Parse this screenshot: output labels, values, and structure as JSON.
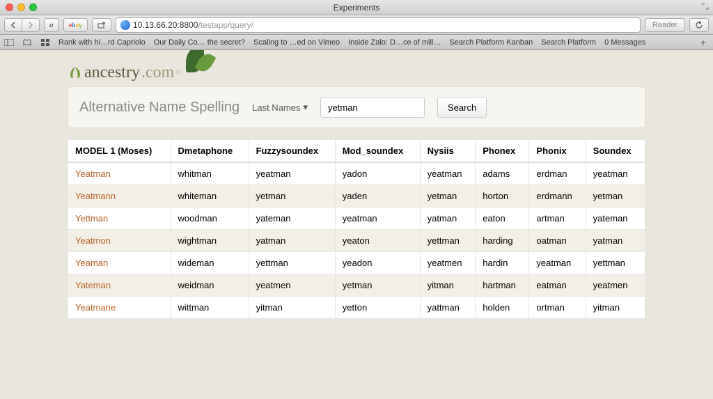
{
  "window": {
    "title": "Experiments"
  },
  "url": {
    "host": "10.13.66.20:8800",
    "path": "/testapp/query/"
  },
  "toolbar": {
    "reader_label": "Reader"
  },
  "bookmarks": {
    "items": [
      "Rank with hi…rd Capriolo",
      "Our Daily Co… the secret?",
      "Scaling to …ed on Vimeo",
      "Inside Zalo: D…ce of mill…",
      "Search Platform Kanban",
      "Search Platform",
      "0 Messages"
    ]
  },
  "brand": {
    "name": "ancestry",
    "suffix": ".com"
  },
  "search": {
    "title": "Alternative Name Spelling",
    "dropdown_label": "Last Names",
    "input_value": "yetman",
    "button_label": "Search"
  },
  "table": {
    "headers": [
      "MODEL 1 (Moses)",
      "Dmetaphone",
      "Fuzzysoundex",
      "Mod_soundex",
      "Nysiis",
      "Phonex",
      "Phonix",
      "Soundex"
    ],
    "rows": [
      [
        "Yeatman",
        "whitman",
        "yeatman",
        "yadon",
        "yeatman",
        "adams",
        "erdman",
        "yeatman"
      ],
      [
        "Yeatmann",
        "whiteman",
        "yetman",
        "yaden",
        "yetman",
        "horton",
        "erdmann",
        "yetman"
      ],
      [
        "Yettman",
        "woodman",
        "yateman",
        "yeatman",
        "yatman",
        "eaton",
        "artman",
        "yateman"
      ],
      [
        "Yeatmon",
        "wightman",
        "yatman",
        "yeaton",
        "yettman",
        "harding",
        "oatman",
        "yatman"
      ],
      [
        "Yeaman",
        "wideman",
        "yettman",
        "yeadon",
        "yeatmen",
        "hardin",
        "yeatman",
        "yettman"
      ],
      [
        "Yateman",
        "weidman",
        "yeatmen",
        "yetman",
        "yitman",
        "hartman",
        "eatman",
        "yeatmen"
      ],
      [
        "Yeatmane",
        "wittman",
        "yitman",
        "yetton",
        "yattman",
        "holden",
        "ortman",
        "yitman"
      ]
    ]
  }
}
